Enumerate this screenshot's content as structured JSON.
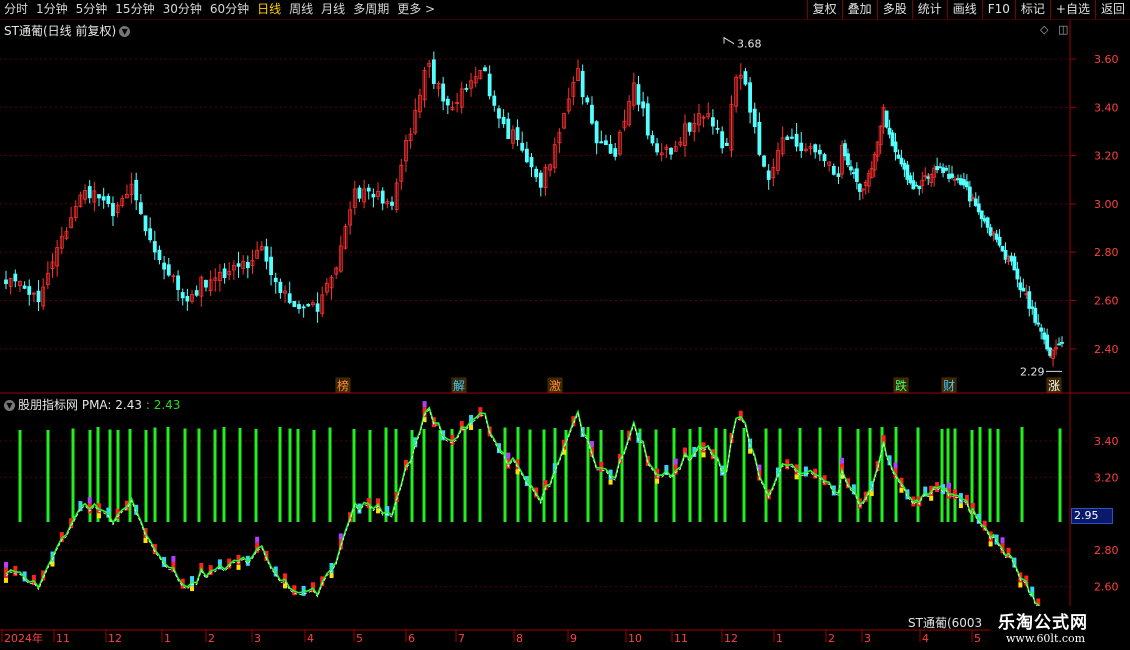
{
  "toolbar": {
    "periods": [
      "分时",
      "1分钟",
      "5分钟",
      "15分钟",
      "30分钟",
      "60分钟",
      "日线",
      "周线",
      "月线",
      "多周期",
      "更多 >"
    ],
    "active_period": "日线",
    "right_buttons": [
      "复权",
      "叠加",
      "多股",
      "统计",
      "画线",
      "F10",
      "标记",
      "+自选",
      "返回"
    ]
  },
  "main_chart": {
    "title": "ST通葡(日线 前复权)",
    "y_ticks": [
      "3.60",
      "3.40",
      "3.20",
      "3.00",
      "2.80",
      "2.60",
      "2.40"
    ],
    "high_label": "3.68",
    "low_label": "2.29",
    "event_tags": [
      {
        "text": "榜",
        "color": "#ff8a3a"
      },
      {
        "text": "解",
        "color": "#44c8ff"
      },
      {
        "text": "激",
        "color": "#ff8a3a"
      },
      {
        "text": "跌",
        "color": "#44ff66"
      },
      {
        "text": "财",
        "color": "#44c8ff"
      },
      {
        "text": "涨",
        "color": "#ffffff"
      }
    ]
  },
  "indicator": {
    "name": "股朋指标网",
    "pma_label": "PMA: 2.43",
    "pma_value": ": 2.43",
    "y_ticks": [
      "3.40",
      "3.20",
      "2.80",
      "2.60"
    ],
    "price_tag": "2.95"
  },
  "x_axis": {
    "labels": [
      "2024年",
      "11",
      "12",
      "1",
      "2",
      "3",
      "4",
      "5",
      "6",
      "7",
      "8",
      "9",
      "10",
      "11",
      "12",
      "1",
      "2",
      "3",
      "4",
      "5"
    ]
  },
  "stock_label": "ST通葡(6003",
  "watermark": {
    "title": "乐淘公式网",
    "url": "www.60lt.com"
  },
  "colors": {
    "up": "#ff3030",
    "down": "#54ffff",
    "bar": "#22ee22",
    "grid": "#5a0000",
    "axis": "#a00000"
  }
}
